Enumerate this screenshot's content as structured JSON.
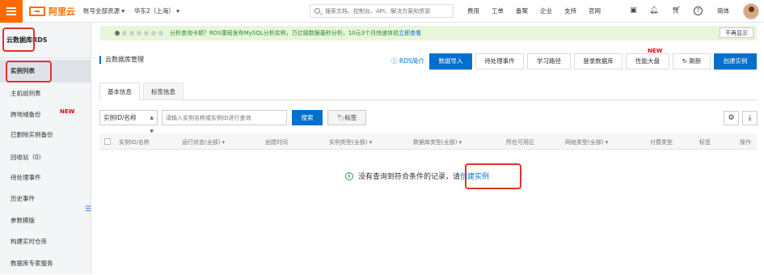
{
  "topbar": {
    "logo_text": "阿里云",
    "account_dd": "账号全部资源 ▾",
    "region_dd": "华东2（上海） ▾",
    "search_placeholder": "搜索文档、控制台、API、解决方案和资源",
    "links": [
      "费用",
      "工单",
      "备案",
      "企业",
      "支持",
      "官网"
    ],
    "lang": "简体"
  },
  "sidebar": {
    "title": "云数据库RDS",
    "items": [
      {
        "label": "实例列表"
      },
      {
        "label": "主机组列表"
      },
      {
        "label": "跨地域备份",
        "badge": "NEW"
      },
      {
        "label": "已删除实例备份"
      },
      {
        "label": "回收站（0）"
      },
      {
        "label": "待处理事件"
      },
      {
        "label": "历史事件"
      },
      {
        "label": "参数模版"
      },
      {
        "label": "构建实时仓库"
      },
      {
        "label": "数据库专家服务"
      }
    ]
  },
  "notice": {
    "text": "分析查询卡顿？RDS重磅发布MySQL分析实例，万亿级数据毫秒分析，10元3个月快速体验",
    "link": "立即查看",
    "dismiss": "不再显示"
  },
  "header": {
    "title": "云数据库管理",
    "help": "RDS简介",
    "buttons": [
      "数据导入",
      "待处理事件",
      "学习路径",
      "登录数据库",
      "性能大盘",
      "刷新",
      "创建实例"
    ],
    "new_badge": "NEW"
  },
  "tabs": [
    "基本信息",
    "标签信息"
  ],
  "filter": {
    "select_value": "实例ID/名称",
    "input_placeholder": "请输入实例名称或实例ID进行查询",
    "search_label": "搜索",
    "tag_label": "标签"
  },
  "table": {
    "columns": [
      "实例ID/名称",
      "运行状态(全部) ▾",
      "创建时间",
      "实例类型(全部) ▾",
      "数据库类型(全部) ▾",
      "所在可用区",
      "网络类型(全部) ▾",
      "付费类型",
      "标签",
      "操作"
    ]
  },
  "empty": {
    "text": "没有查询到符合条件的记录，请",
    "link": "创建实例"
  },
  "colors": {
    "brand": "#ff6a00",
    "primary": "#0070cc",
    "highlight": "#e0332b"
  }
}
